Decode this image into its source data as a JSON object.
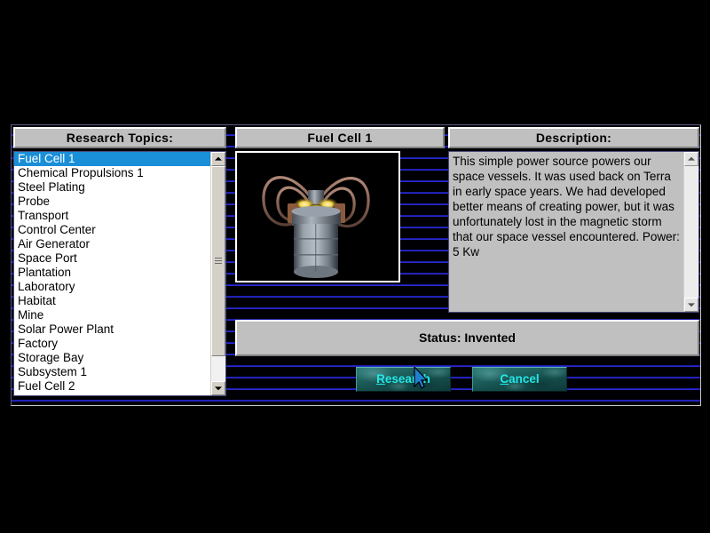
{
  "window": {
    "background_color": "#000004",
    "scanline_color": "#2a2ad0"
  },
  "panels": {
    "topics_header": "Research Topics:",
    "title_header": "Fuel Cell 1",
    "description_header": "Description:"
  },
  "topics_list": {
    "selected_index": 0,
    "selection_color": "#1a8fd8",
    "items": [
      "Fuel Cell 1",
      "Chemical Propulsions 1",
      "Steel Plating",
      "Probe",
      "Transport",
      "Control Center",
      "Air Generator",
      "Space Port",
      "Plantation",
      "Laboratory",
      "Habitat",
      "Mine",
      "Solar Power Plant",
      "Factory",
      "Storage Bay",
      "Subsystem 1",
      "Fuel Cell 2"
    ]
  },
  "preview": {
    "item_name": "Fuel Cell 1",
    "alt": "3D render of a gray cylindrical fuel cell with copper coils and glowing yellow emitters on a black background"
  },
  "description": {
    "text": "This simple power source powers our space vessels.  It was used back on Terra in early space years. We had developed better means of creating power, but it was unfortunately lost in the magnetic storm that our space vessel encountered.  Power: 5 Kw"
  },
  "status": {
    "label": "Status: Invented"
  },
  "buttons": {
    "research": {
      "accel": "R",
      "rest": "esearch",
      "color": "#22e8e8"
    },
    "cancel": {
      "accel": "C",
      "rest": "ancel",
      "color": "#22e8e8"
    }
  },
  "scrollbars": {
    "topics": {
      "up_icon": "triangle-up-icon",
      "down_icon": "triangle-down-icon"
    },
    "description": {
      "up_icon": "triangle-up-icon",
      "down_icon": "triangle-down-icon"
    }
  },
  "cursor": {
    "icon": "arrow-pointer-icon"
  }
}
